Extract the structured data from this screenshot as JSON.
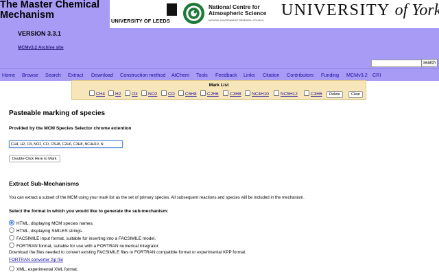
{
  "header": {
    "title_line1": "The Master Chemical",
    "title_line2": "Mechanism",
    "version": "VERSION 3.3.1",
    "archive_link": "MCMv3.2 Archive site",
    "leeds_logo_text": "UNIVERSITY OF LEEDS",
    "ncas_line1": "National Centre for",
    "ncas_line2": "Atmospheric Science",
    "ncas_sub": "NATURAL ENVIRONMENT RESEARCH COUNCIL",
    "york_part1": "UNIVERSITY",
    "york_part2": "of York",
    "search_button": "search"
  },
  "nav": [
    "Home",
    "Browse",
    "Search",
    "Extract",
    "Download",
    "Construction method",
    "AtChem",
    "Tools",
    "Feedback",
    "Links",
    "Citation",
    "Contributors",
    "Funding",
    "MCMv3.2",
    "CRI"
  ],
  "mark_list": {
    "title": "Mark List",
    "species": [
      "CH4",
      "H2",
      "O3",
      "NO2",
      "CO",
      "C5H8",
      "C2H6",
      "C3H8",
      "NC4H10",
      "NC5H12",
      "C3H6"
    ],
    "delete_button": "Delete",
    "clear_button": "Clear"
  },
  "pasteable": {
    "heading": "Pasteable marking of species",
    "subheading": "Provided by the MCM Species Selector chrome extention",
    "input_value": "CH4, H2, O3, NO2, CO, C5H8, C2H6, C3H8, NC4H10, N",
    "mark_button": "Double-Click Here to Mark"
  },
  "extract": {
    "heading": "Extract Sub-Mechanisms",
    "intro": "You can extract a subset of the MCM using your mark list as the set of primary species. All subsequent reactions and species will be included in the mechanism.",
    "format_prompt": "Select the format in which you would like to generate the sub-mechanism:",
    "options": [
      "HTML, displaying MCM species names.",
      "HTML, displaying SMILES strings.",
      "FACSIMILE input format, suitable for inserting into a FACSIMILE model.",
      "FORTRAN format, suitable for use with a FORTRAN numerical integrator."
    ],
    "selected_option": 0,
    "download_note": "Download the files needed to convert existing FACSIMILE files to FORTRAN compatible format or experimental KPP format.",
    "fortran_link": "FORTRAN converter zip file",
    "xml_option": "XML, experimental XML format."
  },
  "colors": {
    "header_bg": "#a79bf5",
    "mark_panel_bg": "#f7e6b9",
    "link": "#1a0fa0",
    "ncas_green": "#1f7a3a"
  },
  "icons": [
    "leeds-crest-icon",
    "ncas-emblem-icon",
    "checkbox-icon",
    "radio-icon"
  ]
}
